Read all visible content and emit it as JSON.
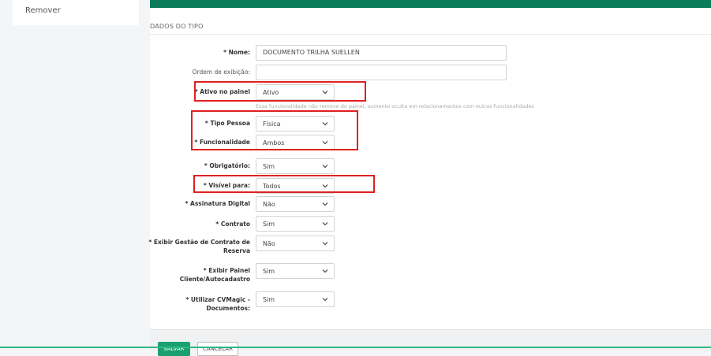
{
  "sidebar": {
    "items": [
      {
        "label": "Remover"
      }
    ]
  },
  "section": {
    "title": "DADOS DO TIPO"
  },
  "form": {
    "nome": {
      "label": "* Nome:",
      "value": "DOCUMENTO TRILHA SUELLEN"
    },
    "ordem": {
      "label": "Ordem de exibição:",
      "value": ""
    },
    "ativo_painel": {
      "label": "* Ativo no painel",
      "value": "Ativo",
      "hint": "Essa funcionalidade não remove do painel, somente oculta em relacionamentos com outras funcionalidades"
    },
    "tipo_pessoa": {
      "label": "* Tipo Pessoa",
      "value": "Física"
    },
    "funcionalidade": {
      "label": "* Funcionalidade",
      "value": "Ambos"
    },
    "obrigatorio": {
      "label": "* Obrigatório:",
      "value": "Sim"
    },
    "visivel_para": {
      "label": "* Visível para:",
      "value": "Todos"
    },
    "assinatura_digital": {
      "label": "* Assinatura Digital",
      "value": "Não"
    },
    "contrato": {
      "label": "* Contrato",
      "value": "Sim"
    },
    "exibir_gestao": {
      "label_line1": "* Exibir Gestão de Contrato de",
      "label_line2": "Reserva",
      "value": "Não"
    },
    "exibir_painel": {
      "label_line1": "* Exibir Painel",
      "label_line2": "Cliente/Autocadastro",
      "value": "Sim"
    },
    "cvmagic": {
      "label_line1": "* Utilizar CVMagic -",
      "label_line2": "Documentos:",
      "value": "Sim"
    }
  },
  "footer": {
    "save_label": "SALVAR",
    "cancel_label": "CANCELAR"
  },
  "colors": {
    "brand": "#0c7b5a",
    "highlight": "#e02020",
    "save": "#1aa070"
  },
  "icons": {
    "select_arrow": "chevron-down-icon"
  }
}
